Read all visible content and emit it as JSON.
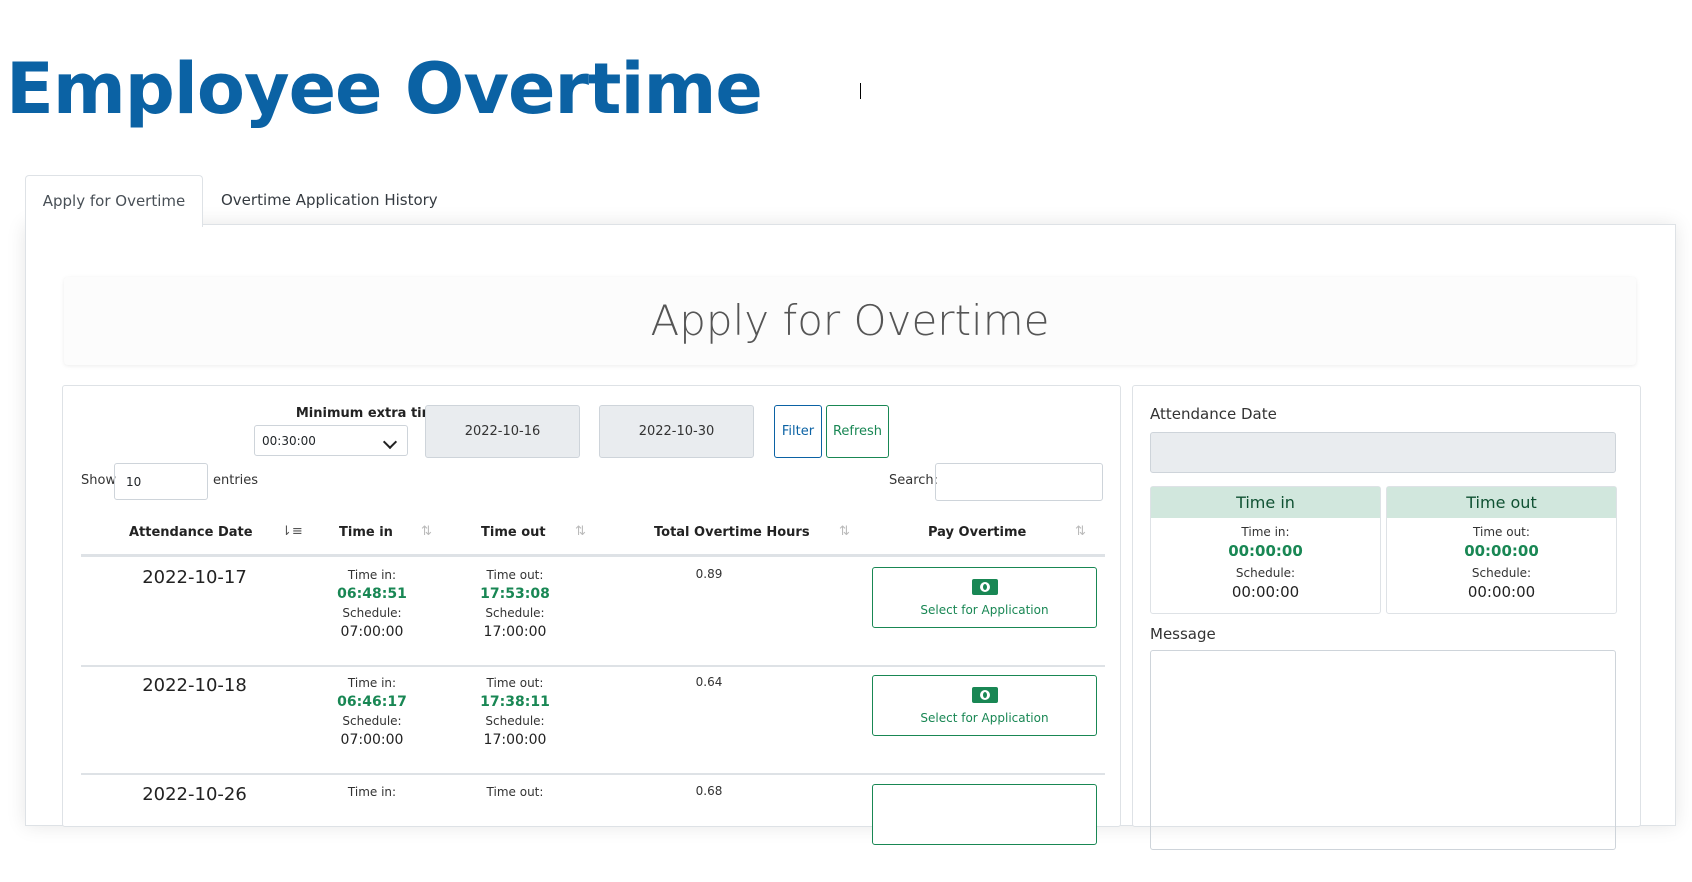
{
  "header": {
    "title": "Employee Overtime"
  },
  "tabs": [
    {
      "label": "Apply for Overtime"
    },
    {
      "label": "Overtime Application History"
    }
  ],
  "section": {
    "title": "Apply for Overtime"
  },
  "filters": {
    "min_extra_label": "Minimum extra time",
    "min_extra_value": "00:30:00",
    "date_from": "2022-10-16",
    "date_to": "2022-10-30",
    "filter_label": "Filter",
    "refresh_label": "Refresh"
  },
  "table_controls": {
    "show_label": "Show",
    "show_value": "10",
    "entries_label": "entries",
    "search_label": "Search:"
  },
  "table": {
    "columns": [
      "Attendance Date",
      "Time in",
      "Time out",
      "Total Overtime Hours",
      "Pay Overtime"
    ],
    "rows": [
      {
        "date": "2022-10-17",
        "time_in_cap": "Time in:",
        "time_in": "06:48:51",
        "sched_cap": "Schedule:",
        "sched_in": "07:00:00",
        "time_out_cap": "Time out:",
        "time_out": "17:53:08",
        "sched_out": "17:00:00",
        "ot": "0.89",
        "action": "Select for Application"
      },
      {
        "date": "2022-10-18",
        "time_in_cap": "Time in:",
        "time_in": "06:46:17",
        "sched_cap": "Schedule:",
        "sched_in": "07:00:00",
        "time_out_cap": "Time out:",
        "time_out": "17:38:11",
        "sched_out": "17:00:00",
        "ot": "0.64",
        "action": "Select for Application"
      },
      {
        "date": "2022-10-26",
        "time_in_cap": "Time in:",
        "time_out_cap": "Time out:",
        "ot": "0.68"
      }
    ]
  },
  "side": {
    "date_label": "Attendance Date",
    "time_in": {
      "title": "Time in",
      "cap": "Time in:",
      "value": "00:00:00",
      "sched_cap": "Schedule:",
      "sched": "00:00:00"
    },
    "time_out": {
      "title": "Time out",
      "cap": "Time out:",
      "value": "00:00:00",
      "sched_cap": "Schedule:",
      "sched": "00:00:00"
    },
    "message_label": "Message"
  },
  "colors": {
    "brand": "#0b62a4",
    "success": "#198754",
    "success_bg": "#d1e7dd"
  }
}
